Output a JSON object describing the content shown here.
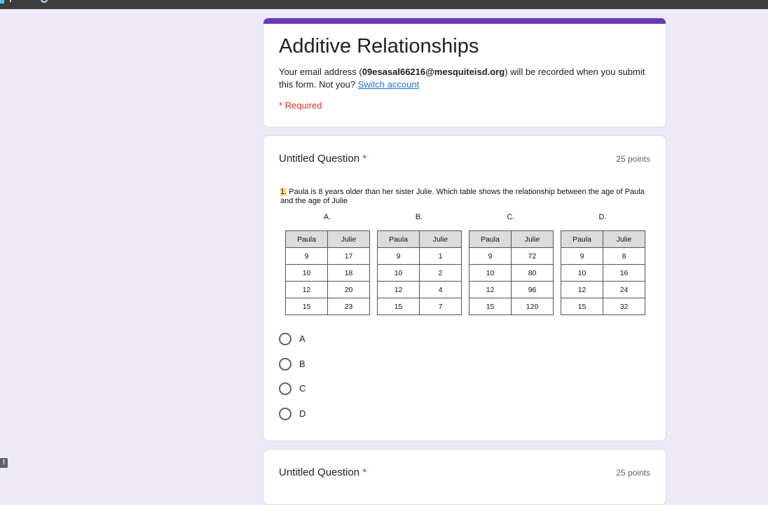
{
  "form": {
    "title": "Additive Relationships",
    "email_prefix": "Your email address (",
    "email": "09esasal66216@mesquiteisd.org",
    "email_suffix": ") will be recorded when you submit this form. Not you?",
    "switch_account": "Switch account",
    "required_note": "* Required",
    "accent_color": "#673ab7"
  },
  "questions": [
    {
      "title": "Untitled Question",
      "required_mark": "*",
      "points": "25 points",
      "image": {
        "number": "1.",
        "text": " Paula is 8 years older than her sister Julie. Which table shows the relationship between the age of Paula and the age of Julie",
        "tables": [
          {
            "letter": "A.",
            "headers": [
              "Paula",
              "Julie"
            ],
            "rows": [
              [
                "9",
                "17"
              ],
              [
                "10",
                "18"
              ],
              [
                "12",
                "20"
              ],
              [
                "15",
                "23"
              ]
            ]
          },
          {
            "letter": "B.",
            "headers": [
              "Paula",
              "Julie"
            ],
            "rows": [
              [
                "9",
                "1"
              ],
              [
                "10",
                "2"
              ],
              [
                "12",
                "4"
              ],
              [
                "15",
                "7"
              ]
            ]
          },
          {
            "letter": "C.",
            "headers": [
              "Paula",
              "Julie"
            ],
            "rows": [
              [
                "9",
                "72"
              ],
              [
                "10",
                "80"
              ],
              [
                "12",
                "96"
              ],
              [
                "15",
                "120"
              ]
            ]
          },
          {
            "letter": "D.",
            "headers": [
              "Paula",
              "Julie"
            ],
            "rows": [
              [
                "9",
                "8"
              ],
              [
                "10",
                "16"
              ],
              [
                "12",
                "24"
              ],
              [
                "15",
                "32"
              ]
            ]
          }
        ]
      },
      "choices": [
        "A",
        "B",
        "C",
        "D"
      ]
    },
    {
      "title": "Untitled Question",
      "required_mark": "*",
      "points": "25 points"
    }
  ],
  "feedback_badge": "!"
}
